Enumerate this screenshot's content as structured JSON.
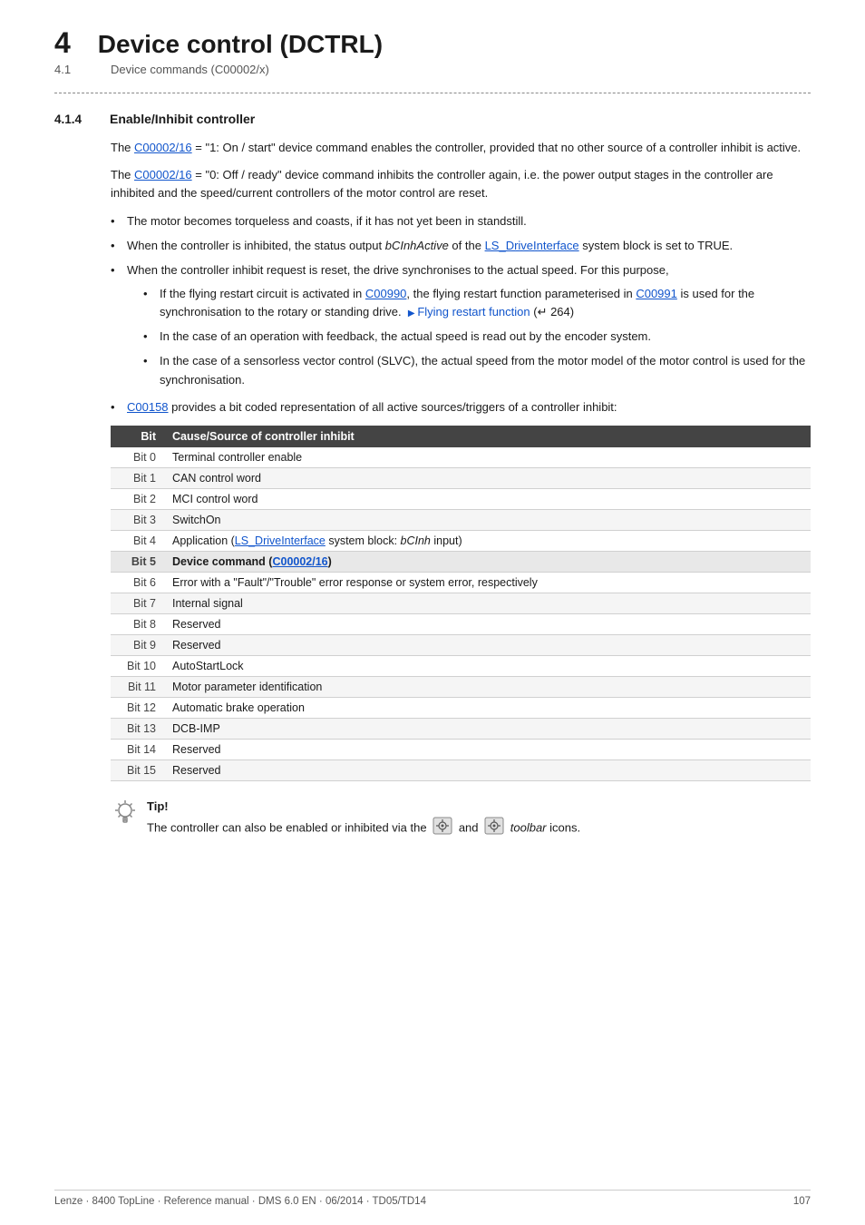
{
  "header": {
    "chapter_num": "4",
    "chapter_title": "Device control (DCTRL)",
    "sub_num": "4.1",
    "sub_title": "Device commands (C00002/x)"
  },
  "section": {
    "num": "4.1.4",
    "title": "Enable/Inhibit controller"
  },
  "paragraphs": [
    {
      "id": "p1",
      "text_parts": [
        {
          "type": "text",
          "content": "The "
        },
        {
          "type": "link",
          "content": "C00002/16"
        },
        {
          "type": "text",
          "content": " = \"1: On / start\" device command enables the controller, provided that no other source of a controller inhibit is active."
        }
      ]
    },
    {
      "id": "p2",
      "text_parts": [
        {
          "type": "text",
          "content": "The "
        },
        {
          "type": "link",
          "content": "C00002/16"
        },
        {
          "type": "text",
          "content": " = \"0: Off / ready\" device command inhibits the controller again, i.e. the power output stages in the controller are inhibited and the speed/current controllers of the motor control are reset."
        }
      ]
    }
  ],
  "bullets": [
    {
      "id": "b1",
      "text": "The motor becomes torqueless and coasts, if it has not yet been in standstill."
    },
    {
      "id": "b2",
      "text_parts": [
        {
          "type": "text",
          "content": "When the controller is inhibited, the status output "
        },
        {
          "type": "italic",
          "content": "bCInhActive"
        },
        {
          "type": "text",
          "content": " of the "
        },
        {
          "type": "link",
          "content": "LS_DriveInterface"
        },
        {
          "type": "text",
          "content": " system block is set to TRUE."
        }
      ]
    },
    {
      "id": "b3",
      "text": "When the controller inhibit request is reset, the drive synchronises to the actual speed. For this purpose,",
      "sub_bullets": [
        {
          "id": "sb1",
          "text_parts": [
            {
              "type": "text",
              "content": "If the flying restart circuit is activated in "
            },
            {
              "type": "link",
              "content": "C00990"
            },
            {
              "type": "text",
              "content": ", the flying restart function parameterised in "
            },
            {
              "type": "link",
              "content": "C00991"
            },
            {
              "type": "text",
              "content": " is used for the synchronisation to the rotary or standing drive.  "
            },
            {
              "type": "arrow-link",
              "content": "Flying restart function"
            },
            {
              "type": "text",
              "content": " ("
            },
            {
              "type": "icon",
              "content": "↵"
            },
            {
              "type": "text",
              "content": " 264)"
            }
          ]
        },
        {
          "id": "sb2",
          "text": "In the case of an operation with feedback, the actual speed is read out by the encoder system."
        },
        {
          "id": "sb3",
          "text": "In the case of a sensorless vector control (SLVC), the actual speed from the motor model of the motor control is used for the synchronisation."
        }
      ]
    },
    {
      "id": "b4",
      "text_parts": [
        {
          "type": "link",
          "content": "C00158"
        },
        {
          "type": "text",
          "content": " provides a bit coded representation of all active sources/triggers of a controller inhibit:"
        }
      ]
    }
  ],
  "table": {
    "headers": [
      "Bit",
      "Cause/Source of controller inhibit"
    ],
    "rows": [
      {
        "bit": "Bit 0",
        "cause": "Terminal controller enable",
        "highlight": false
      },
      {
        "bit": "Bit 1",
        "cause": "CAN control word",
        "highlight": false
      },
      {
        "bit": "Bit 2",
        "cause": "MCI control word",
        "highlight": false
      },
      {
        "bit": "Bit 3",
        "cause": "SwitchOn",
        "highlight": false
      },
      {
        "bit": "Bit 4",
        "cause": "Application (LS_DriveInterface system block: bCInh input)",
        "highlight": false,
        "has_link": true
      },
      {
        "bit": "Bit 5",
        "cause": "Device command (C00002/16)",
        "highlight": true,
        "has_link": true
      },
      {
        "bit": "Bit 6",
        "cause": "Error with a \"Fault\"/\"Trouble\" error response or system error, respectively",
        "highlight": false
      },
      {
        "bit": "Bit 7",
        "cause": "Internal signal",
        "highlight": false
      },
      {
        "bit": "Bit 8",
        "cause": "Reserved",
        "highlight": false
      },
      {
        "bit": "Bit 9",
        "cause": "Reserved",
        "highlight": false
      },
      {
        "bit": "Bit 10",
        "cause": "AutoStartLock",
        "highlight": false
      },
      {
        "bit": "Bit 11",
        "cause": "Motor parameter identification",
        "highlight": false
      },
      {
        "bit": "Bit 12",
        "cause": "Automatic brake operation",
        "highlight": false
      },
      {
        "bit": "Bit 13",
        "cause": "DCB-IMP",
        "highlight": false
      },
      {
        "bit": "Bit 14",
        "cause": "Reserved",
        "highlight": false
      },
      {
        "bit": "Bit 15",
        "cause": "Reserved",
        "highlight": false
      }
    ]
  },
  "tip": {
    "label": "Tip!",
    "text_parts": [
      {
        "type": "text",
        "content": "The controller can also be enabled or inhibited via the "
      },
      {
        "type": "toolbar-icon",
        "content": ""
      },
      {
        "type": "text",
        "content": " and "
      },
      {
        "type": "toolbar-icon",
        "content": ""
      },
      {
        "type": "italic",
        "content": " toolbar"
      },
      {
        "type": "text",
        "content": " icons."
      }
    ]
  },
  "footer": {
    "left": "Lenze · 8400 TopLine · Reference manual · DMS 6.0 EN · 06/2014 · TD05/TD14",
    "right": "107"
  }
}
